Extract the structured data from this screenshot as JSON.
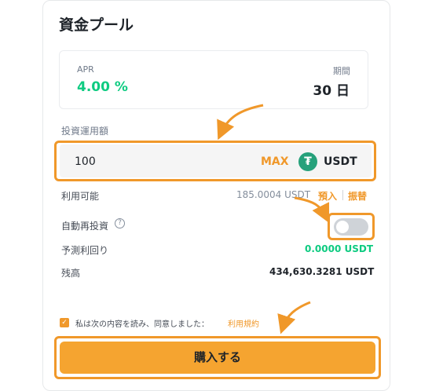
{
  "title": "資金プール",
  "apr": {
    "label": "APR",
    "value": "4.00 %"
  },
  "term": {
    "label": "期間",
    "value": "30 日"
  },
  "amount": {
    "label": "投資運用額",
    "value": "100",
    "max_label": "MAX",
    "currency_icon": "tether-icon",
    "currency": "USDT"
  },
  "available": {
    "label": "利用可能",
    "value": "185.0004 USDT",
    "deposit_label": "預入",
    "transfer_label": "振替"
  },
  "auto_reinvest": {
    "label": "自動再投資",
    "help_icon": "help-icon",
    "help_glyph": "?",
    "enabled": false
  },
  "predicted_interest": {
    "label": "予測利回り",
    "value": "0.0000 USDT"
  },
  "balance": {
    "label": "残高",
    "value": "434,630.3281 USDT"
  },
  "agreement": {
    "checked": true,
    "text": "私は次の内容を読み、同意しました：",
    "link_label": "利用規約"
  },
  "buy_button": {
    "label": "購入する"
  },
  "colors": {
    "accent": "#f0982a",
    "green": "#0ecb81",
    "button": "#f5a430",
    "tether": "#26a17b"
  }
}
